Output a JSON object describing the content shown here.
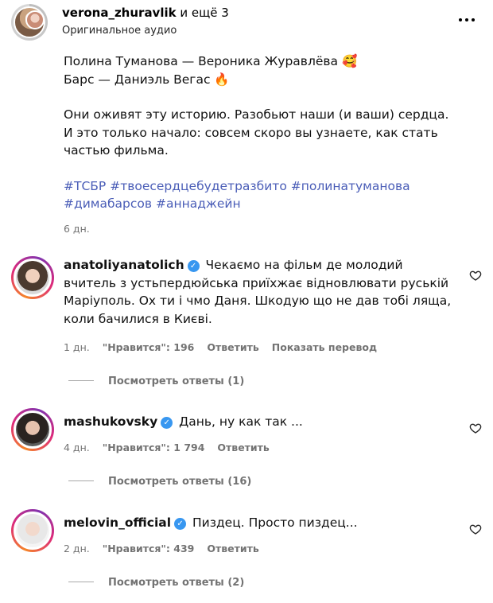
{
  "header": {
    "username": "verona_zhuravlik",
    "others": " и ещё 3",
    "audio": "Оригинальное аудио"
  },
  "caption": {
    "line1": "Полина Туманова — Вероника Журавлёва 🥰",
    "line2": "Барс — Даниэль Вегас 🔥",
    "line3": "Они оживят эту историю. Разобьют наши (и ваши) сердца.",
    "line4": "И это только начало: совсем скоро вы узнаете, как стать",
    "line5": "частью фильма.",
    "hashtags_line1": [
      "#ТСБР",
      "#твоесердцебудетразбито",
      "#полинатуманова"
    ],
    "hashtags_line2": [
      "#димабарсов",
      "#аннаджейн"
    ],
    "time": "6 дн."
  },
  "comments": [
    {
      "username": "anatoliyanatolich",
      "text": "Чекаємо на фільм де молодий вчитель з устьпердюйська приїхжає відновлювати руській Маріуполь. Ох ти і чмо Даня. Шкодую що не дав тобі ляща, коли бачилися в Києві.",
      "time": "1 дн.",
      "likes": "\"Нравится\": 196",
      "reply": "Ответить",
      "translate": "Показать перевод",
      "replies": "Посмотреть ответы (1)"
    },
    {
      "username": "mashukovsky",
      "text": "Дань, ну как так ...",
      "time": "4 дн.",
      "likes": "\"Нравится\": 1 794",
      "reply": "Ответить",
      "replies": "Посмотреть ответы (16)"
    },
    {
      "username": "melovin_official",
      "text": "Пиздец. Просто пиздец...",
      "time": "2 дн.",
      "likes": "\"Нравится\": 439",
      "reply": "Ответить",
      "replies": "Посмотреть ответы (2)"
    }
  ],
  "icons": {
    "verified": "verified-badge-icon",
    "like": "heart-outline-icon",
    "more": "more-dots-icon"
  },
  "colors": {
    "hashtag": "#4a5db7",
    "verified": "#3897f0",
    "meta": "#737373"
  }
}
